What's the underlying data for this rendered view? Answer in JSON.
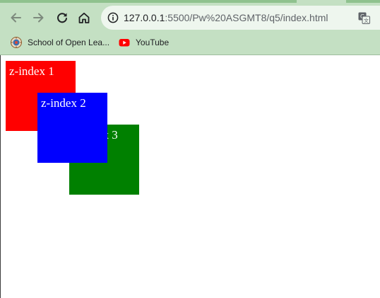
{
  "browser": {
    "url_host": "127.0.0.1",
    "url_path": ":5500/Pw%20ASGMT8/q5/index.html",
    "bookmarks": [
      {
        "label": "School of Open Lea...",
        "icon": "institution-seal-icon"
      },
      {
        "label": "YouTube",
        "icon": "youtube-icon"
      }
    ],
    "colors": {
      "toolbar": "#c4e0c3",
      "omnibox": "#eef6ee"
    }
  },
  "page": {
    "boxes": [
      {
        "label": "z-index 1",
        "color": "#ff0000"
      },
      {
        "label": "z-index 2",
        "color": "#0000ff"
      },
      {
        "label": "z-index 3",
        "color": "#008000"
      }
    ]
  }
}
